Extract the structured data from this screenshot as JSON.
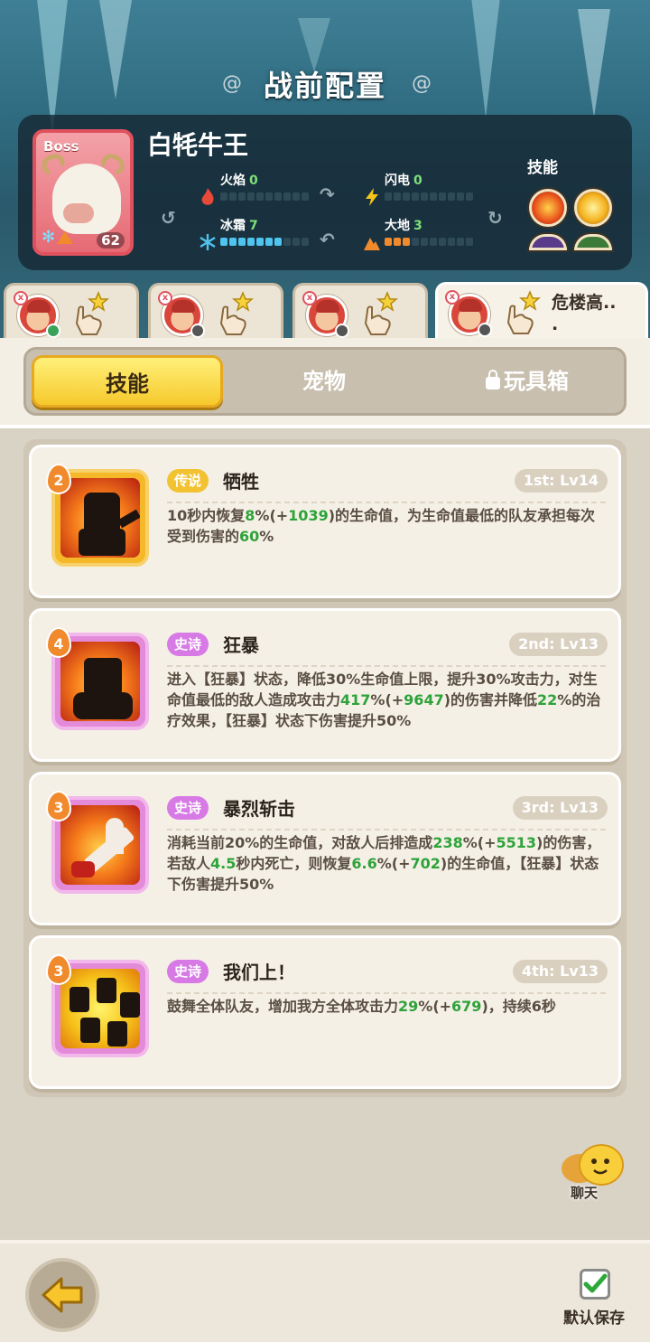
{
  "header": {
    "title": "战前配置"
  },
  "boss": {
    "tag": "Boss",
    "name": "白牦牛王",
    "level": "62",
    "skills_label": "技能",
    "elements": [
      {
        "name": "火焰",
        "value": "0",
        "icon": "fire-icon",
        "color": "#e84a3a"
      },
      {
        "name": "闪电",
        "value": "0",
        "icon": "lightning-icon",
        "color": "#f5c518"
      },
      {
        "name": "冰霜",
        "value": "7",
        "icon": "snowflake-icon",
        "color": "#4ec4ee"
      },
      {
        "name": "大地",
        "value": "3",
        "icon": "earth-icon",
        "color": "#f08a2c"
      }
    ]
  },
  "team_tabs": [
    {
      "label": "",
      "active": false
    },
    {
      "label": "",
      "active": false
    },
    {
      "label": "",
      "active": false
    },
    {
      "label": "危楼高..\n.",
      "active": true
    }
  ],
  "segments": {
    "skills": "技能",
    "pets": "宠物",
    "toybox": "玩具箱",
    "active": "skills"
  },
  "skills": [
    {
      "rank": "2",
      "rarity": "传说",
      "rarity_type": "legend",
      "name": "牺牲",
      "slot": "1st: Lv14",
      "desc": [
        {
          "t": "10秒内恢复"
        },
        {
          "t": "8",
          "g": true
        },
        {
          "t": "%(+"
        },
        {
          "t": "1039",
          "g": true
        },
        {
          "t": ")的生命值，为生命值最低的队友承担每次受到伤害的"
        },
        {
          "t": "60",
          "g": true
        },
        {
          "t": "%"
        }
      ]
    },
    {
      "rank": "4",
      "rarity": "史诗",
      "rarity_type": "epic",
      "name": "狂暴",
      "slot": "2nd: Lv13",
      "desc": [
        {
          "t": "进入【狂暴】状态，降低30%生命值上限，提升30%攻击力，对生命值最低的敌人造成攻击力"
        },
        {
          "t": "417",
          "g": true
        },
        {
          "t": "%(+"
        },
        {
          "t": "9647",
          "g": true
        },
        {
          "t": ")的伤害并降低"
        },
        {
          "t": "22",
          "g": true
        },
        {
          "t": "%的治疗效果，【狂暴】状态下伤害提升50%"
        }
      ]
    },
    {
      "rank": "3",
      "rarity": "史诗",
      "rarity_type": "epic",
      "name": "暴烈斩击",
      "slot": "3rd: Lv13",
      "desc": [
        {
          "t": "消耗当前20%的生命值，对敌人后排造成"
        },
        {
          "t": "238",
          "g": true
        },
        {
          "t": "%(+"
        },
        {
          "t": "5513",
          "g": true
        },
        {
          "t": ")的伤害，若敌人"
        },
        {
          "t": "4.5",
          "g": true
        },
        {
          "t": "秒内死亡，则恢复"
        },
        {
          "t": "6.6",
          "g": true
        },
        {
          "t": "%(+"
        },
        {
          "t": "702",
          "g": true
        },
        {
          "t": ")的生命值，【狂暴】状态下伤害提升50%"
        }
      ]
    },
    {
      "rank": "3",
      "rarity": "史诗",
      "rarity_type": "epic",
      "name": "我们上！",
      "slot": "4th: Lv13",
      "desc": [
        {
          "t": "鼓舞全体队友，增加我方全体攻击力"
        },
        {
          "t": "29",
          "g": true
        },
        {
          "t": "%(+"
        },
        {
          "t": "679",
          "g": true
        },
        {
          "t": ")，持续6秒"
        }
      ]
    }
  ],
  "chat": {
    "label": "聊天"
  },
  "footer": {
    "default_save": "默认保存",
    "default_save_checked": true
  }
}
